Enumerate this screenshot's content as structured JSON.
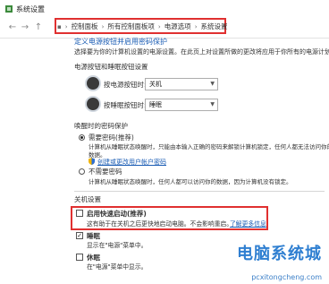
{
  "window": {
    "title": "系统设置"
  },
  "breadcrumb": [
    "控制面板",
    "所有控制面板项",
    "电源选项",
    "系统设置"
  ],
  "heading": "定义电源按钮并启用密码保护",
  "intro": "选择要为你的计算机设置的电源设置。在此页上对设置所做的更改将应用于你所有的电源计划。",
  "power_buttons": {
    "section": "电源按钮和睡眠按钮设置",
    "rows": [
      {
        "label": "按电源按钮时:",
        "value": "关机"
      },
      {
        "label": "按睡眠按钮时:",
        "value": "睡眠"
      }
    ]
  },
  "password": {
    "section": "唤醒时的密码保护",
    "require_label": "需要密码(推荐)",
    "require_desc_1": "计算机从睡眠状态唤醒时，只能由本输入正确的密码来解锁计算机锁定，任何人都无法访问你的",
    "require_desc_2": "数据。",
    "require_link": "创建或更改用户帐户密码",
    "none_label": "不需要密码",
    "none_desc": "计算机从睡眠状态唤醒时，任何人都可以访问你的数据，因为计算机没有锁定。"
  },
  "shutdown": {
    "section": "关机设置",
    "fast_startup_label": "启用快速启动(推荐)",
    "fast_startup_desc": "这有助于在关机之后更快地启动电脑。不会影响重启。",
    "fast_startup_link": "了解更多信息",
    "sleep_label": "睡眠",
    "sleep_desc": "显示在\"电源\"菜单中。",
    "hibernate_label": "休眠",
    "hibernate_desc": "在\"电源\"菜单中显示。"
  },
  "watermark": {
    "brand": "电脑系统城",
    "url": "pcxitongcheng.com"
  },
  "colors": {
    "highlight": "#e03030",
    "link": "#1a5cb4"
  }
}
